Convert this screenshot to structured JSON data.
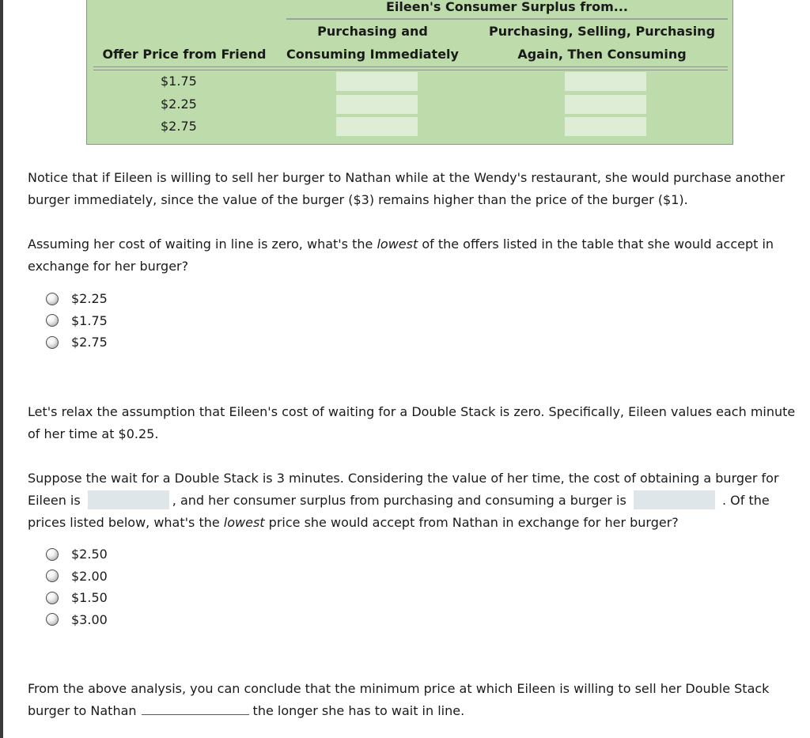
{
  "table": {
    "super_header": "Eileen's Consumer Surplus from...",
    "col0_header": "Offer Price from Friend",
    "col1_header_line1": "Purchasing and",
    "col1_header_line2": "Consuming Immediately",
    "col2_header_line1": "Purchasing, Selling, Purchasing",
    "col2_header_line2": "Again, Then Consuming",
    "rows": [
      {
        "price": "$1.75",
        "surplus_immediate": "",
        "surplus_resell": ""
      },
      {
        "price": "$2.25",
        "surplus_immediate": "",
        "surplus_resell": ""
      },
      {
        "price": "$2.75",
        "surplus_immediate": "",
        "surplus_resell": ""
      }
    ]
  },
  "notice": {
    "text": "Notice that if Eileen is willing to sell her burger to Nathan while at the Wendy's restaurant, she would purchase another burger immediately, since the value of the burger ($3) remains higher than the price of the burger ($1)."
  },
  "question1": {
    "prefix": "Assuming her cost of waiting in line is zero, what's the ",
    "emphasis": "lowest",
    "suffix": " of the offers listed in the table that she would accept in exchange for her burger?",
    "options": [
      "$2.25",
      "$1.75",
      "$2.75"
    ],
    "selected": null
  },
  "relax": {
    "text": "Let's relax the assumption that Eileen's cost of waiting for a Double Stack is zero. Specifically, Eileen values each minute of her time at $0.25."
  },
  "question2": {
    "part1": "Suppose the wait for a Double Stack is 3 minutes.  Considering the value of her time, the cost of obtaining a burger for Eileen is",
    "cost_value": "",
    "part2": ", and her consumer surplus from purchasing and consuming a burger is",
    "surplus_value": "",
    "part3": ". Of the prices listed below, what's the ",
    "emphasis": "lowest",
    "part4": " price she would accept from Nathan in exchange for her burger?",
    "options": [
      "$2.50",
      "$2.00",
      "$1.50",
      "$3.00"
    ],
    "selected": null
  },
  "conclusion": {
    "part1": "From the above analysis, you can conclude that the minimum price at which Eileen is willing to sell her Double Stack burger to Nathan",
    "dropdown_value": "",
    "part2": "the longer she has to wait in line."
  }
}
